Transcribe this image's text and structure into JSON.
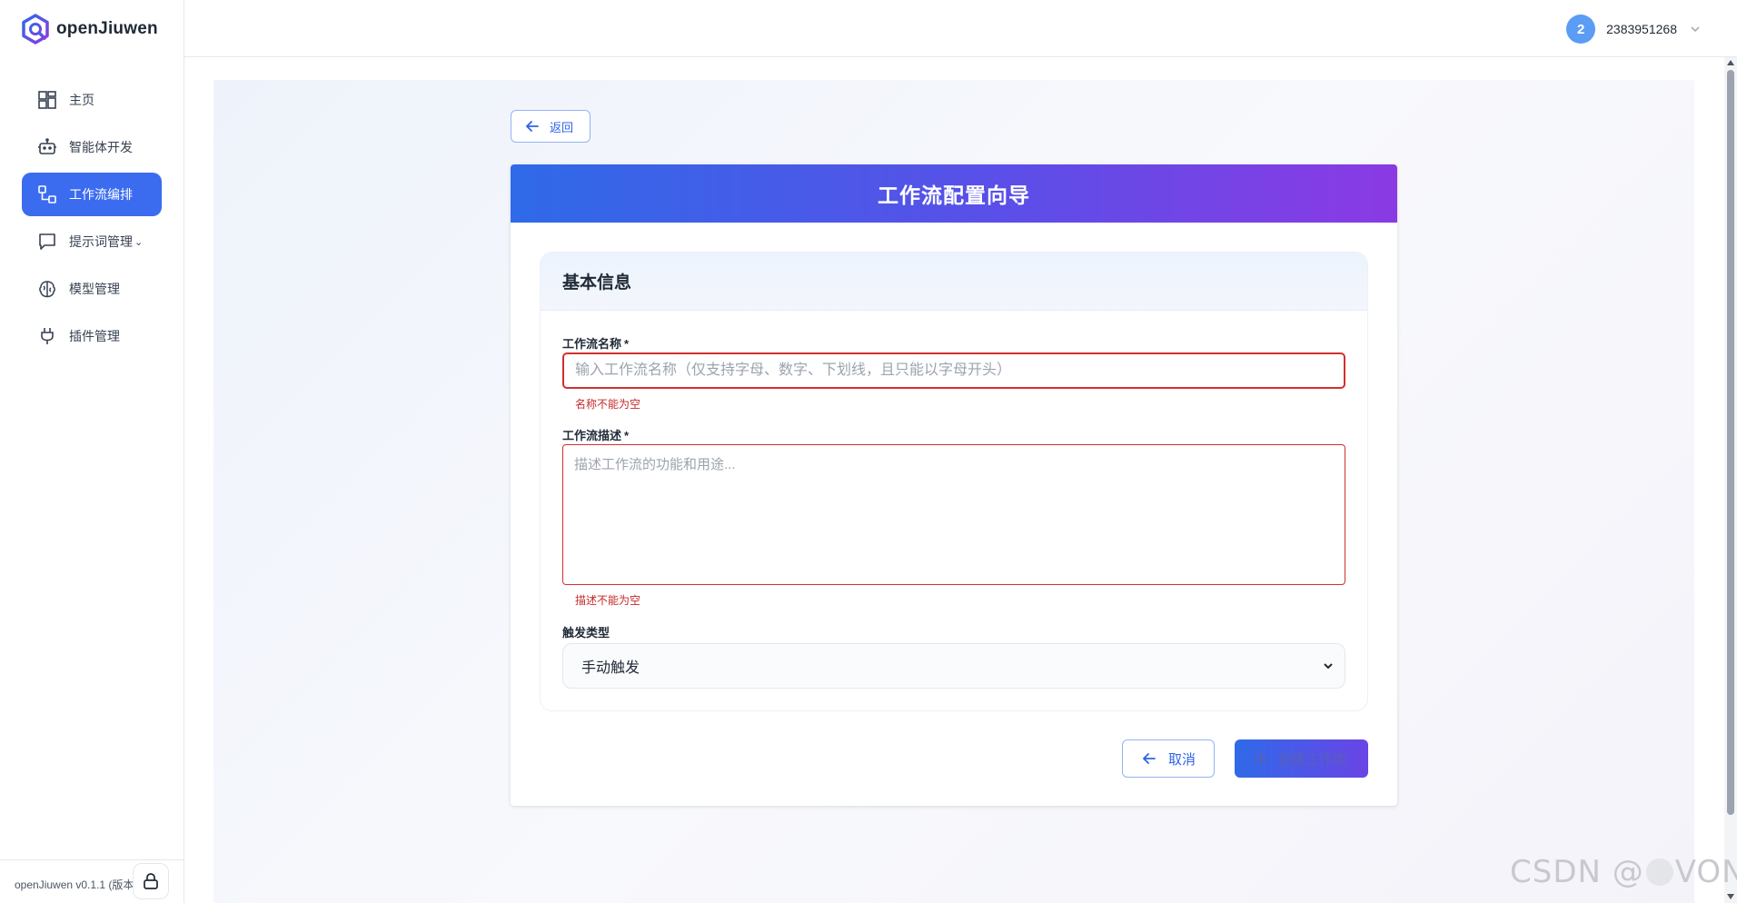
{
  "app": {
    "name": "openJiuwen",
    "version": "openJiuwen v0.1.1 (版本)"
  },
  "sidebar": {
    "items": [
      {
        "label": "主页",
        "icon": "dashboard-icon",
        "active": false
      },
      {
        "label": "智能体开发",
        "icon": "robot-icon",
        "active": false
      },
      {
        "label": "工作流编排",
        "icon": "workflow-icon",
        "active": true
      },
      {
        "label": "提示词管理",
        "icon": "message-icon",
        "active": false,
        "has_caret": true
      },
      {
        "label": "模型管理",
        "icon": "brain-icon",
        "active": false
      },
      {
        "label": "插件管理",
        "icon": "plug-icon",
        "active": false
      }
    ]
  },
  "header": {
    "avatar_letter": "2",
    "username": "2383951268"
  },
  "page": {
    "back_label": "返回",
    "title": "工作流配置向导",
    "section_title": "基本信息",
    "name_label": "工作流名称",
    "required_mark": "*",
    "name_placeholder": "输入工作流名称（仅支持字母、数字、下划线，且只能以字母开头）",
    "name_value": "",
    "name_error": "名称不能为空",
    "desc_label": "工作流描述",
    "desc_placeholder": "描述工作流的功能和用途...",
    "desc_value": "",
    "desc_error": "描述不能为空",
    "trigger_label": "触发类型",
    "trigger_selected": "手动触发",
    "cancel_label": "取消",
    "create_label": "创建工作流"
  },
  "watermark": {
    "prefix": "CSDN @",
    "suffix": "VON"
  },
  "colors": {
    "accent": "#3b6cf0",
    "gradient_start": "#2f6ae8",
    "gradient_end": "#8b3ae3",
    "error": "#d32f2f",
    "avatar": "#5b9cf4"
  }
}
